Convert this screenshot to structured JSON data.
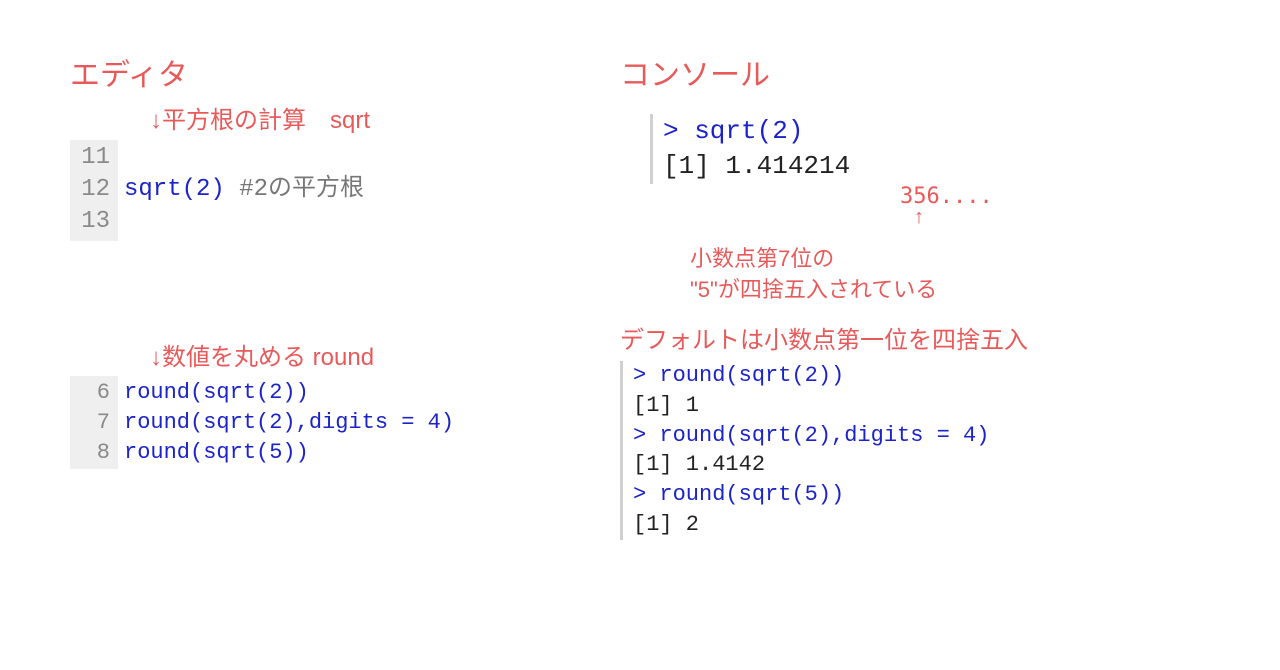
{
  "left": {
    "heading": "エディタ",
    "annot1": "↓平方根の計算　sqrt",
    "editor1": {
      "gutter": [
        "11",
        "12",
        "13"
      ],
      "line12_fn": "sqrt",
      "line12_open": "(",
      "line12_arg": "2",
      "line12_close": ")",
      "line12_comment": " #2の平方根"
    },
    "annot2": "↓数値を丸める round",
    "editor2": {
      "gutter": [
        "6",
        "7",
        "8"
      ],
      "l6": "round(sqrt(2))",
      "l7": "round(sqrt(2),digits = 4)",
      "l8": "round(sqrt(5))"
    }
  },
  "right": {
    "heading": "コンソール",
    "console1": {
      "p1": "> sqrt(2)",
      "o1": "[1] 1.414214"
    },
    "trunc": {
      "val": "356....",
      "arrow": "↑"
    },
    "annot_round_a": "小数点第7位の",
    "annot_round_b": "\"5\"が四捨五入されている",
    "annot_default": "デフォルトは小数点第一位を四捨五入",
    "console2": {
      "p1": "> round(sqrt(2))",
      "o1": "[1] 1",
      "p2": "> round(sqrt(2),digits = 4)",
      "o2": "[1] 1.4142",
      "p3": "> round(sqrt(5))",
      "o3": "[1] 2"
    }
  }
}
